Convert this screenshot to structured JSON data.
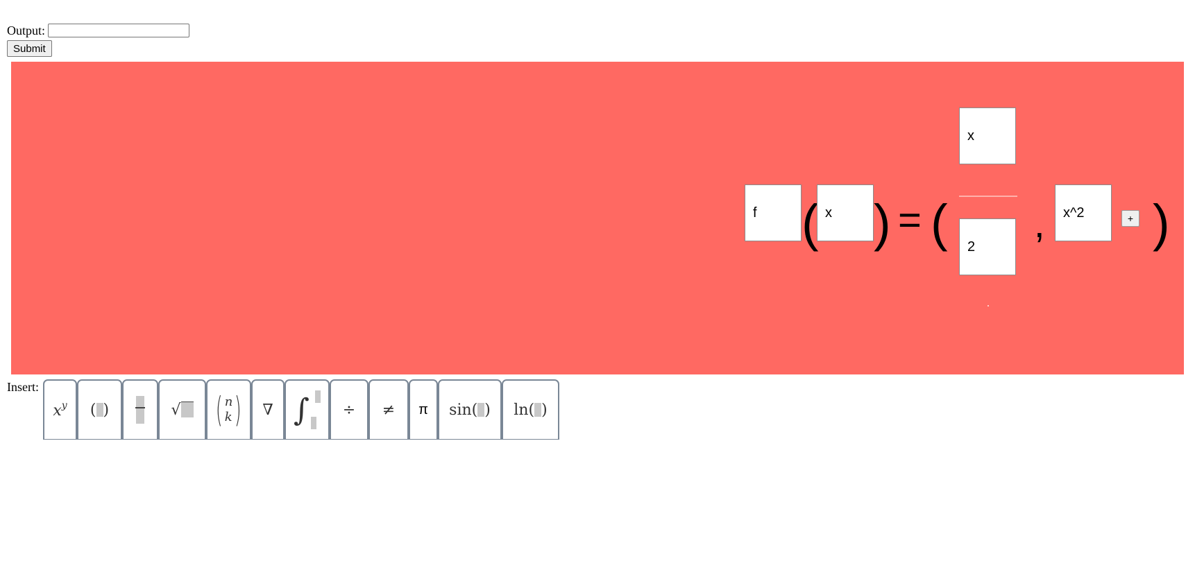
{
  "form": {
    "output_label": "Output:",
    "output_value": "",
    "submit_label": "Submit"
  },
  "equation": {
    "function_name": "f",
    "argument": "x",
    "open_paren": "(",
    "close_paren": ")",
    "equals": "=",
    "tuple_open": "(",
    "tuple_close": ")",
    "numerator": "x",
    "denominator": "2",
    "separator": ",",
    "second_component": "x^2",
    "add_button_label": "+"
  },
  "toolbar": {
    "label": "Insert:",
    "buttons": [
      {
        "name": "power",
        "label": "x^y"
      },
      {
        "name": "parentheses",
        "label": "( )"
      },
      {
        "name": "fraction",
        "label": "fraction"
      },
      {
        "name": "sqrt",
        "label": "√"
      },
      {
        "name": "binomial",
        "label": "(n k)"
      },
      {
        "name": "nabla",
        "label": "∇"
      },
      {
        "name": "integral",
        "label": "∫"
      },
      {
        "name": "divide",
        "label": "÷"
      },
      {
        "name": "not-equal",
        "label": "≠"
      },
      {
        "name": "pi",
        "label": "π"
      },
      {
        "name": "sin",
        "label": "sin"
      },
      {
        "name": "ln",
        "label": "ln"
      }
    ]
  },
  "colors": {
    "canvas_background": "#ff6962",
    "toolbar_border": "#7a8796"
  }
}
